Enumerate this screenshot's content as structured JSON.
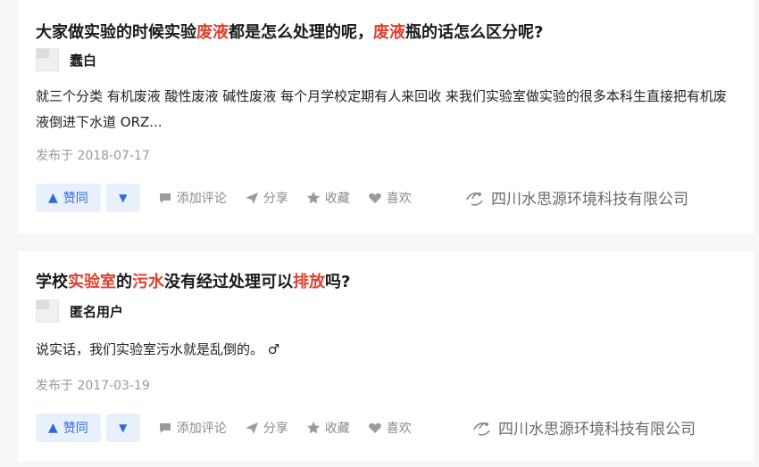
{
  "answers": [
    {
      "title_parts": [
        {
          "text": "大家做实验的时候实验",
          "hl": false
        },
        {
          "text": "废液",
          "hl": true
        },
        {
          "text": "都是怎么处理的呢，",
          "hl": false
        },
        {
          "text": "废液",
          "hl": true
        },
        {
          "text": "瓶的话怎么区分呢?",
          "hl": false
        }
      ],
      "author": "蠢白",
      "content": "就三个分类 有机废液 酸性废液 碱性废液 每个月学校定期有人来回收 来我们实验室做实验的很多本科生直接把有机废液倒进下水道 ORZ...",
      "date": "发布于 2018-07-17"
    },
    {
      "title_parts": [
        {
          "text": "学校",
          "hl": false
        },
        {
          "text": "实验室",
          "hl": true
        },
        {
          "text": "的",
          "hl": false
        },
        {
          "text": "污水",
          "hl": true
        },
        {
          "text": "没有经过处理可以",
          "hl": false
        },
        {
          "text": "排放",
          "hl": true
        },
        {
          "text": "吗?",
          "hl": false
        }
      ],
      "author": "匿名用户",
      "content": "说实话，我们实验室污水就是乱倒的。 ♂",
      "date": "发布于 2017-03-19"
    }
  ],
  "actions": {
    "upvote": "赞同",
    "comment": "添加评论",
    "share": "分享",
    "collect": "收藏",
    "like": "喜欢"
  },
  "watermark": "四川水思源环境科技有限公司",
  "colors": {
    "highlight": "#e0402f",
    "vote_bg": "#e8f0fb",
    "vote_text": "#2e6bd9",
    "meta": "#9a9a9a"
  }
}
